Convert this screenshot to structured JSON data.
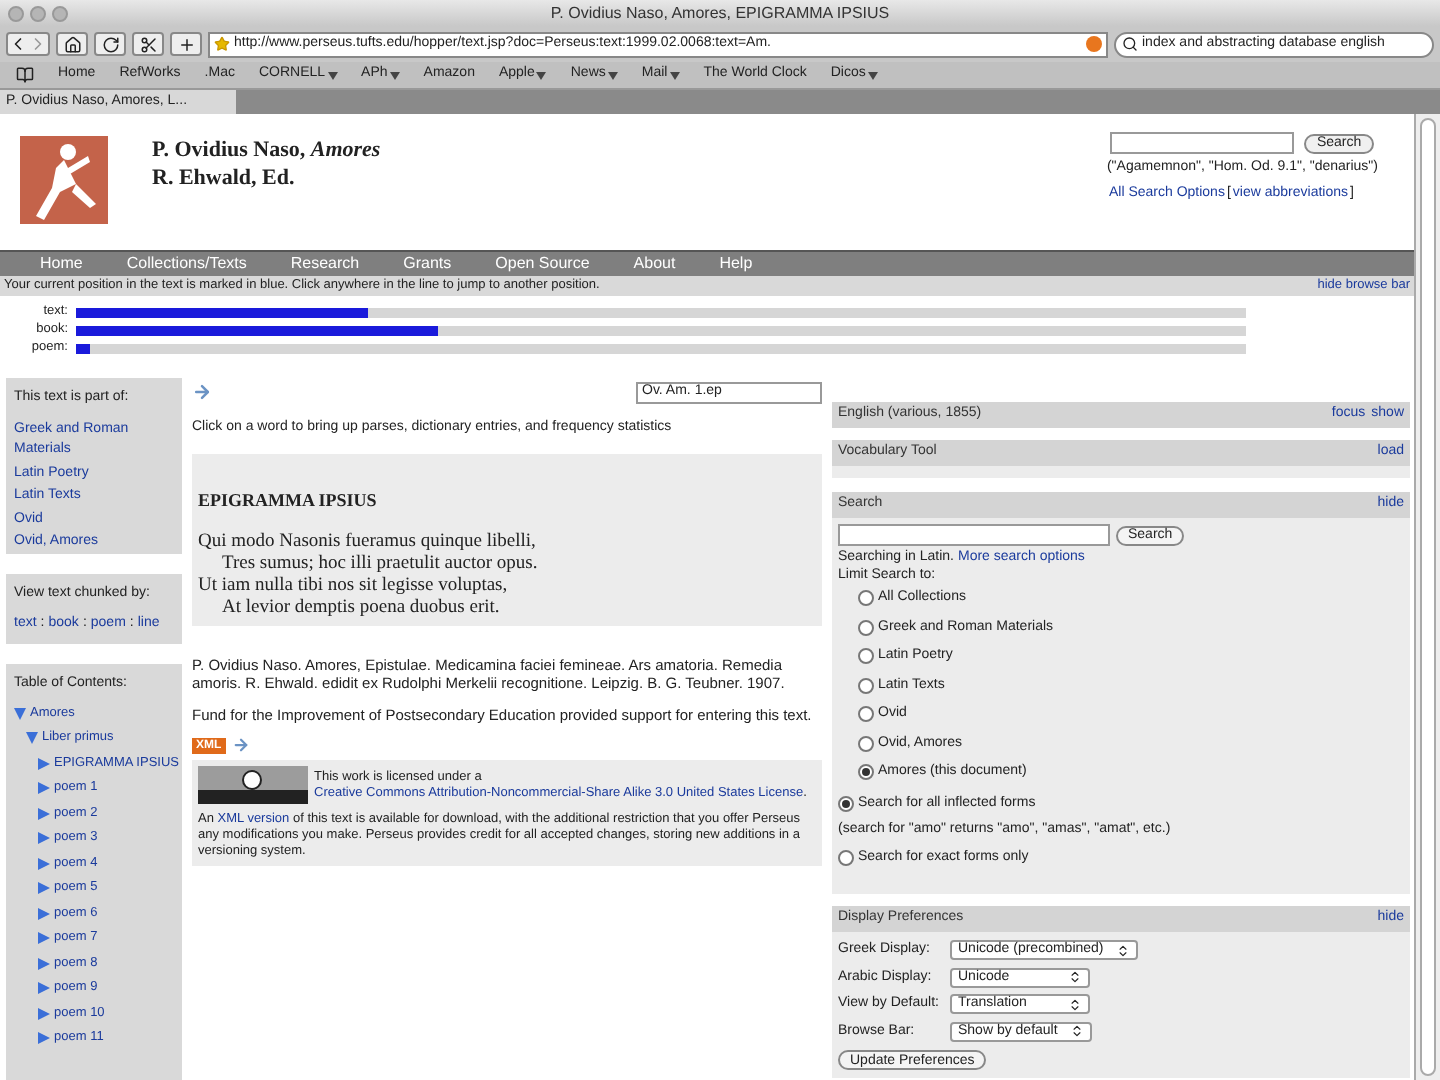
{
  "window": {
    "title": "P. Ovidius Naso, Amores, EPIGRAMMA IPSIUS"
  },
  "toolbar": {
    "url": "http://www.perseus.tufts.edu/hopper/text.jsp?doc=Perseus:text:1999.02.0068:text=Am.",
    "search_value": "index and abstracting database english"
  },
  "bookmarks": [
    {
      "label": "Home",
      "menu": false
    },
    {
      "label": "RefWorks",
      "menu": false
    },
    {
      "label": ".Mac",
      "menu": false
    },
    {
      "label": "CORNELL",
      "menu": true
    },
    {
      "label": "APh",
      "menu": true
    },
    {
      "label": "Amazon",
      "menu": false
    },
    {
      "label": "Apple",
      "menu": true
    },
    {
      "label": "News",
      "menu": true
    },
    {
      "label": "Mail",
      "menu": true
    },
    {
      "label": "The World Clock",
      "menu": false
    },
    {
      "label": "Dicos",
      "menu": true
    }
  ],
  "tabs": [
    {
      "label": "P. Ovidius Naso, Amores, L...",
      "selected": true
    }
  ],
  "header": {
    "title": "P. Ovidius Naso, *Amores*",
    "editor": "R. Ehwald, Ed.",
    "search_button": "Search",
    "search_hint": "(\"Agamemnon\", \"Hom. Od. 9.1\", \"denarius\")",
    "links": [
      {
        "kind": "link",
        "text": "All Search Options"
      },
      {
        "kind": "text",
        "text": "["
      },
      {
        "kind": "link",
        "text": "view abbreviations"
      },
      {
        "kind": "text",
        "text": "]"
      }
    ]
  },
  "nav": [
    "Home",
    "Collections/Texts",
    "Research",
    "Grants",
    "Open Source",
    "About",
    "Help"
  ],
  "browse": {
    "info": "Your current position in the text is marked in blue. Click anywhere in the line to jump to another position.",
    "hide": "hide browse bar",
    "bars": [
      {
        "label": "text:",
        "level": 0.25
      },
      {
        "label": "book:",
        "level": 0.31
      },
      {
        "label": "poem:",
        "level": 0.012
      }
    ]
  },
  "sidebar": {
    "part_of": {
      "title": "This text is part of:",
      "links": [
        "Greek and Roman Materials",
        "Latin Poetry",
        "Latin Texts",
        "Ovid",
        "Ovid, Amores"
      ]
    },
    "chunked": {
      "title": "View text chunked by:",
      "separator": ":",
      "links": [
        "text",
        "book",
        "poem",
        "line"
      ]
    },
    "toc": {
      "title": "Table of Contents:",
      "items": [
        {
          "label": "Amores",
          "expanded": true,
          "children": [
            {
              "label": "Liber primus",
              "expanded": true,
              "children": [
                {
                  "label": "EPIGRAMMA IPSIUS",
                  "expanded": false
                },
                {
                  "label": "poem 1",
                  "expanded": false
                },
                {
                  "label": "poem 2",
                  "expanded": false
                },
                {
                  "label": "poem 3",
                  "expanded": false
                },
                {
                  "label": "poem 4",
                  "expanded": false
                },
                {
                  "label": "poem 5",
                  "expanded": false
                },
                {
                  "label": "poem 6",
                  "expanded": false
                },
                {
                  "label": "poem 7",
                  "expanded": false
                },
                {
                  "label": "poem 8",
                  "expanded": false
                },
                {
                  "label": "poem 9",
                  "expanded": false
                },
                {
                  "label": "poem 10",
                  "expanded": false
                },
                {
                  "label": "poem 11",
                  "expanded": false
                }
              ]
            }
          ]
        }
      ]
    }
  },
  "text": {
    "jump_value": "Ov. Am. 1.ep",
    "instruction": "Click on a word to bring up parses, dictionary entries, and frequency statistics",
    "heading": "EPIGRAMMA IPSIUS",
    "lines": [
      {
        "text": "Qui modo Nasonis fueramus quinque libelli,",
        "indent": false
      },
      {
        "text": "Tres sumus; hoc illi praetulit auctor opus.",
        "indent": true
      },
      {
        "text": "Ut iam nulla tibi nos sit legisse voluptas,",
        "indent": false
      },
      {
        "text": "At levior demptis poena duobus erit.",
        "indent": true
      }
    ],
    "citation": "P. Ovidius Naso. Amores, Epistulae. Medicamina faciei femineae. Ars amatoria. Remedia amoris. R. Ehwald. edidit ex Rudolphi Merkelii recognitione. Leipzig. B. G. Teubner. 1907.",
    "funding": "Fund for the Improvement of Postsecondary Education provided support for entering this text.",
    "xml_badge": "XML",
    "license": {
      "before": "This work is licensed under a ",
      "link": "Creative Commons Attribution-Noncommercial-Share Alike 3.0 United States License",
      "after": "."
    },
    "xml_note": {
      "before": "An ",
      "link": "XML version",
      "after": " of this text is available for download, with the additional restriction that you offer Perseus any modifications you make. Perseus provides credit for all accepted changes, storing new additions in a versioning system."
    }
  },
  "panels": {
    "translation": {
      "title": "English (various, 1855)",
      "actions": [
        "focus",
        "show"
      ]
    },
    "vocabulary": {
      "title": "Vocabulary Tool",
      "actions": [
        "load"
      ]
    },
    "search": {
      "title": "Search",
      "actions": [
        "hide"
      ],
      "button": "Search",
      "language_note": "Searching in Latin.",
      "more_link": "More search options",
      "limit_label": "Limit Search to:",
      "options": [
        {
          "label": "All Collections",
          "selected": false
        },
        {
          "label": "Greek and Roman Materials",
          "selected": false
        },
        {
          "label": "Latin Poetry",
          "selected": false
        },
        {
          "label": "Latin Texts",
          "selected": false
        },
        {
          "label": "Ovid",
          "selected": false
        },
        {
          "label": "Ovid, Amores",
          "selected": false
        },
        {
          "label": "Amores (this document)",
          "selected": true
        }
      ],
      "form_options": [
        {
          "kind": "radio",
          "label": "Search for all inflected forms",
          "selected": true
        },
        {
          "kind": "note",
          "label": "(search for \"amo\" returns \"amo\", \"amas\", \"amat\", etc.)"
        },
        {
          "kind": "radio",
          "label": "Search for exact forms only",
          "selected": false
        }
      ]
    },
    "display": {
      "title": "Display Preferences",
      "actions": [
        "hide"
      ],
      "settings": [
        {
          "label": "Greek Display:",
          "value": "Unicode (precombined)"
        },
        {
          "label": "Arabic Display:",
          "value": "Unicode"
        },
        {
          "label": "View by Default:",
          "value": "Translation"
        },
        {
          "label": "Browse Bar:",
          "value": "Show by default"
        }
      ],
      "button": "Update Preferences"
    }
  }
}
